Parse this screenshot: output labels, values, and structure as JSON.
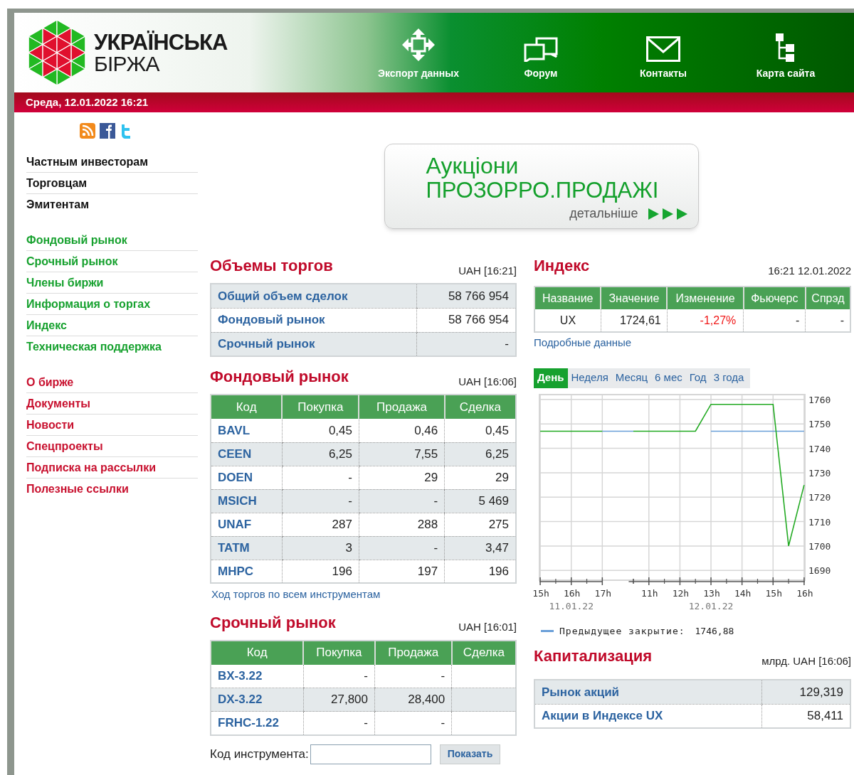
{
  "logo": {
    "line1": "УКРАЇНСЬКА",
    "line2": "БІРЖА"
  },
  "nav": [
    {
      "label": "Экспорт данных"
    },
    {
      "label": "Форум"
    },
    {
      "label": "Контакты"
    },
    {
      "label": "Карта сайта"
    }
  ],
  "date_bar": "Среда, 12.01.2022 16:21",
  "sidebar": {
    "groups": [
      {
        "kind": "audience",
        "items": [
          "Частным инвесторам",
          "Торговцам",
          "Эмитентам"
        ]
      },
      {
        "kind": "market",
        "items": [
          "Фондовый рынок",
          "Срочный рынок",
          "Члены биржи",
          "Информация о торгах",
          "Индекс",
          "Техническая поддержка"
        ]
      },
      {
        "kind": "about",
        "items": [
          "О бирже",
          "Документы",
          "Новости",
          "Спецпроекты",
          "Подписка на рассылки",
          "Полезные ссылки"
        ]
      }
    ]
  },
  "banner": {
    "line1": "Аукціони",
    "line2": "ПРОЗОРРО.ПРОДАЖІ",
    "more": "детальніше"
  },
  "volumes": {
    "title": "Объемы торгов",
    "stamp": "UAH [16:21]",
    "rows": [
      {
        "label": "Общий объем сделок",
        "value": "58 766 954"
      },
      {
        "label": "Фондовый рынок",
        "value": "58 766 954"
      },
      {
        "label": "Срочный рынок",
        "value": "-"
      }
    ]
  },
  "stock_market": {
    "title": "Фондовый рынок",
    "stamp": "UAH [16:06]",
    "columns": [
      "Код",
      "Покупка",
      "Продажа",
      "Сделка"
    ],
    "rows": [
      [
        "BAVL",
        "0,45",
        "0,46",
        "0,45"
      ],
      [
        "CEEN",
        "6,25",
        "7,55",
        "6,25"
      ],
      [
        "DOEN",
        "-",
        "29",
        "29"
      ],
      [
        "MSICH",
        "-",
        "-",
        "5 469"
      ],
      [
        "UNAF",
        "287",
        "288",
        "275"
      ],
      [
        "TATM",
        "3",
        "-",
        "3,47"
      ],
      [
        "MHPC",
        "196",
        "197",
        "196"
      ]
    ],
    "link": "Ход торгов по всем инструментам"
  },
  "derivatives": {
    "title": "Срочный рынок",
    "stamp": "UAH [16:01]",
    "columns": [
      "Код",
      "Покупка",
      "Продажа",
      "Сделка"
    ],
    "rows": [
      [
        "BX-3.22",
        "-",
        "-",
        ""
      ],
      [
        "DX-3.22",
        "27,800",
        "28,400",
        ""
      ],
      [
        "FRHC-1.22",
        "-",
        "-",
        ""
      ]
    ]
  },
  "search_form": {
    "label": "Код инструмента:",
    "button": "Показать"
  },
  "index": {
    "title": "Индекс",
    "stamp": "16:21 12.01.2022",
    "columns": [
      "Название",
      "Значение",
      "Изменение",
      "Фьючерс",
      "Спрэд"
    ],
    "row": {
      "name": "UX",
      "value": "1724,61",
      "change": "-1,27%",
      "futures": "-",
      "spread": "-"
    },
    "link": "Подробные данные",
    "periods": [
      {
        "label": "День",
        "selected": true
      },
      {
        "label": "Неделя",
        "selected": false
      },
      {
        "label": "Месяц",
        "selected": false
      },
      {
        "label": "6 мес",
        "selected": false
      },
      {
        "label": "Год",
        "selected": false
      },
      {
        "label": "3 года",
        "selected": false
      }
    ],
    "date_labels": [
      "11.01.22",
      "12.01.22"
    ],
    "legend": {
      "label": "Предыдущее закрытие:",
      "value": "1746,88"
    },
    "chart_data": {
      "type": "line",
      "categories": [
        "15h",
        null,
        "16h",
        null,
        "17h",
        null,
        null,
        "11h",
        null,
        "12h",
        null,
        "13h",
        null,
        "14h",
        null,
        "15h",
        null,
        "16h"
      ],
      "series": [
        {
          "color": "#22aa22",
          "values": [
            1747,
            1747,
            1747,
            1747,
            1747,
            null,
            1747,
            1747,
            1747,
            1747,
            1747,
            1758,
            1758,
            1758,
            1758,
            1758,
            1700,
            1725
          ]
        },
        {
          "color": "#6a9fd8",
          "values": [
            null,
            null,
            null,
            null,
            1747,
            1747,
            1747,
            null,
            null,
            null,
            null,
            1747,
            1747,
            1747,
            1747,
            1747,
            1747,
            1747
          ]
        }
      ],
      "ylim": [
        1686,
        1762
      ],
      "grid": true,
      "yticks": [
        1690,
        1700,
        1710,
        1720,
        1730,
        1740,
        1750,
        1760
      ]
    }
  },
  "capitalization": {
    "title": "Капитализация",
    "stamp": "млрд. UAH [16:06]",
    "rows": [
      {
        "label": "Рынок акций",
        "value": "129,319"
      },
      {
        "label": "Акции в Индексе UX",
        "value": "58,411"
      }
    ]
  }
}
